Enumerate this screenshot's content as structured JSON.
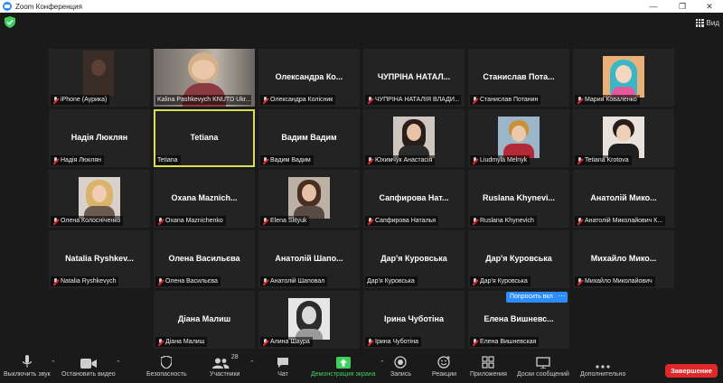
{
  "window": {
    "title": "Zoom Конференция"
  },
  "topbar": {
    "view_label": "Вид"
  },
  "tiles": [
    {
      "big": "",
      "label": "iPhone (Аурика)"
    },
    {
      "big": "",
      "label": "Kalina Pashkevych KNUTD Ukr..."
    },
    {
      "big": "Олександра  Ко...",
      "label": "Олександра Колісник"
    },
    {
      "big": "ЧУПРІНА  НАТАЛ...",
      "label": "ЧУПРІНА НАТАЛІЯ ВЛАДИ..."
    },
    {
      "big": "Станислав  Пота...",
      "label": "Станислав Потанин"
    },
    {
      "big": "",
      "label": "Мария Коваленко"
    },
    {
      "big": "Надія Люклян",
      "label": "Надія Люклян"
    },
    {
      "big": "Tetiana",
      "label": "Tetiana"
    },
    {
      "big": "Вадим Вадим",
      "label": "Вадим Вадим"
    },
    {
      "big": "",
      "label": "Юхимчук Анастасія"
    },
    {
      "big": "",
      "label": "Liudmyla Melnyk"
    },
    {
      "big": "",
      "label": "Tetiana Krotova"
    },
    {
      "big": "",
      "label": "Олена Колосніченко"
    },
    {
      "big": "Oxana  Maznich...",
      "label": "Oxana Maznichenko"
    },
    {
      "big": "",
      "label": "Elena Slityuk"
    },
    {
      "big": "Сапфирова  Нат...",
      "label": "Сапфирова Наталья"
    },
    {
      "big": "Ruslana  Khynevi...",
      "label": "Ruslana Khynevich"
    },
    {
      "big": "Анатолій  Мико...",
      "label": "Анатолій Миколайович К..."
    },
    {
      "big": "Natalia  Ryshkev...",
      "label": "Natalia Ryshkevych"
    },
    {
      "big": "Олена Васильєва",
      "label": "Олена Васильєва"
    },
    {
      "big": "Анатолій  Шапо...",
      "label": "Анатолій Шаповал"
    },
    {
      "big": "Дар'я Куровська",
      "label": "Дар'я Куровська"
    },
    {
      "big": "Дар'я Куровська",
      "label": "Дар'я Куровська"
    },
    {
      "big": "Михайло  Мико...",
      "label": "Михайло Миколайович"
    },
    {
      "big": "Діана Малиш",
      "label": "Діана Малиш"
    },
    {
      "big": "",
      "label": "Алина Шаура"
    },
    {
      "big": "Ірина Чуботіна",
      "label": "Ірина Чуботіна"
    },
    {
      "big": "Елена  Вишневс...",
      "label": "Елена Вишневская"
    }
  ],
  "overlay": {
    "ask_button": "Попросить вкл",
    "more": "···"
  },
  "toolbar": {
    "mute": "Выключить звук",
    "video": "Остановить видео",
    "security": "Безопасность",
    "participants": "Участники",
    "participants_count": "28",
    "chat": "Чат",
    "share": "Демонстрация экрана",
    "record": "Запись",
    "reactions": "Реакции",
    "apps": "Приложения",
    "whiteboards": "Доски сообщений",
    "more": "Дополнительно",
    "end": "Завершение"
  },
  "colors": {
    "accent": "#2d8cff",
    "share_green": "#3ecf5e",
    "end_red": "#e02828",
    "active_border": "#d8df57"
  }
}
